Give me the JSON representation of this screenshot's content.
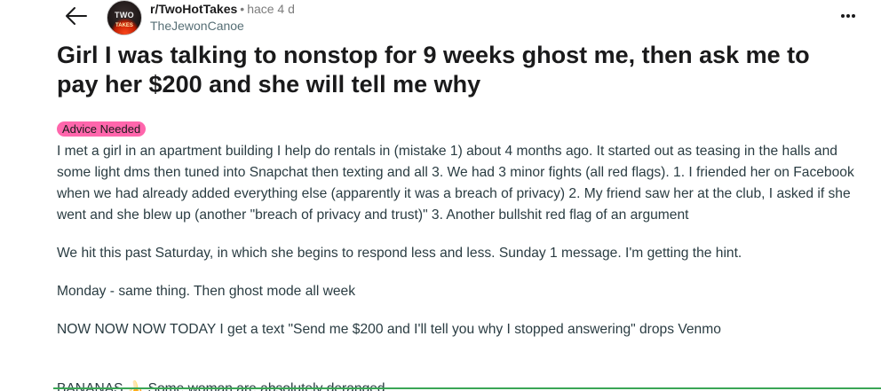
{
  "header": {
    "subreddit": "r/TwoHotTakes",
    "separator": "•",
    "time": "hace 4 d",
    "author": "TheJewonCanoe",
    "avatar_text_top": "TWO",
    "avatar_text_bottom": "TAKES",
    "back_icon": "arrow-left-icon",
    "more_icon": "ellipsis-horizontal-icon"
  },
  "post": {
    "title": "Girl I was talking to nonstop for 9 weeks ghost me, then ask me to pay her $200 and she will tell me why",
    "flair": "Advice Needed",
    "flair_color": "#ff66ac",
    "paragraphs": [
      "I met a girl in an apartment building I help do rentals in (mistake 1) about 4 months ago. It started out as teasing in the halls and some light dms then tuned into Snapchat then texting and all 3. We had 3 minor fights (all red flags). 1. I friended her on Facebook when we had already added everything else (apparently it was a breach of privacy) 2. My friend saw her at the club, I asked if she went and she blew up (another \"breach of privacy and trust)\" 3. Another bullshit red flag of an argument",
      "We hit this past Saturday, in which she begins to respond less and less. Sunday 1 message. I'm getting the hint.",
      "Monday - same thing. Then ghost mode all week",
      "NOW NOW NOW TODAY I get a text \"Send me $200 and I'll tell you why I stopped answering\" drops Venmo"
    ],
    "cut_off_line": "BANANAS 🍌 Some woman are absolutely deranged"
  },
  "colors": {
    "text": "#1a1a1b",
    "body_text": "#2a3c42",
    "muted": "#7c7c7c",
    "author": "#576f76"
  }
}
